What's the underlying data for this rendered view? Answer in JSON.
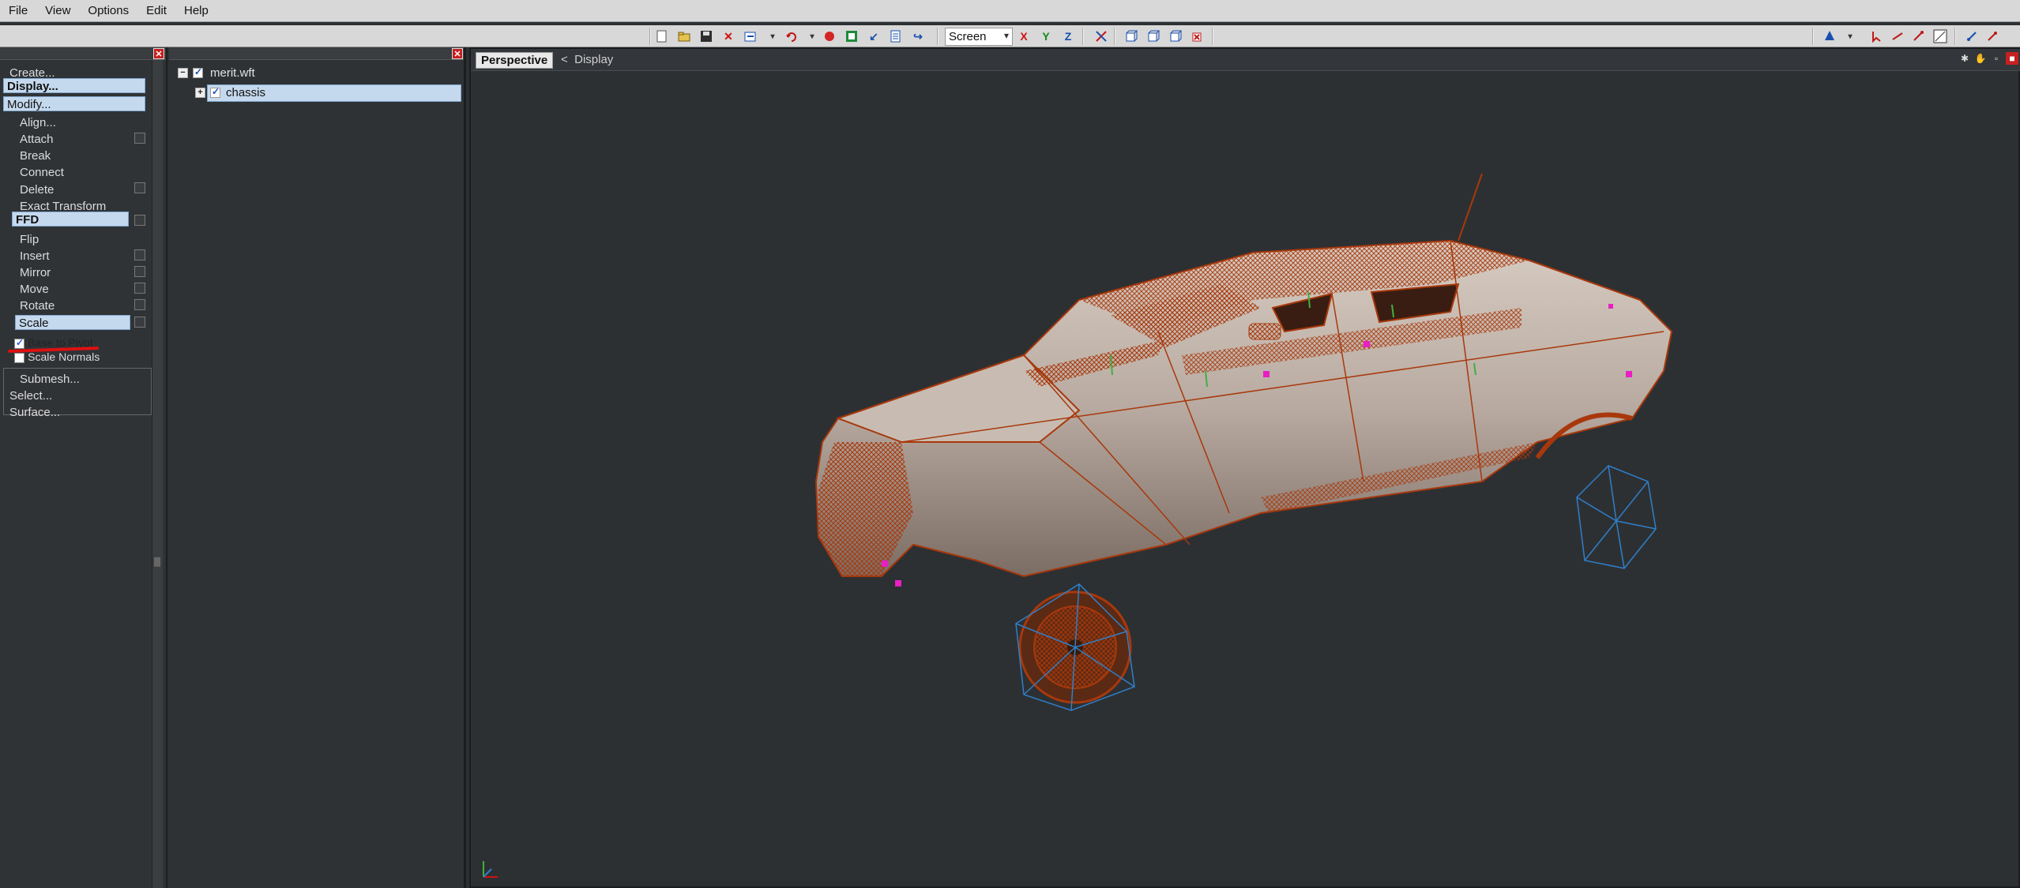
{
  "menu": {
    "file": "File",
    "view": "View",
    "options": "Options",
    "edit": "Edit",
    "help": "Help"
  },
  "toolbar": {
    "space_select": "Screen",
    "axis_x": "X",
    "axis_y": "Y",
    "axis_z": "Z"
  },
  "left_panel": {
    "create": "Create...",
    "display": "Display...",
    "modify": "Modify...",
    "items": [
      "Align...",
      "Attach",
      "Break",
      "Connect",
      "Delete",
      "Exact Transform",
      "FFD",
      "Flip",
      "Insert",
      "Mirror",
      "Move",
      "Rotate",
      "Scale"
    ],
    "option_base_to_pivot": "Base to Pivot",
    "option_scale_normals": "Scale Normals",
    "submesh": "Submesh...",
    "select": "Select...",
    "surface": "Surface..."
  },
  "tree": {
    "root": "merit.wft",
    "child": "chassis"
  },
  "viewport": {
    "tab_active": "Perspective",
    "tab_other": "Display",
    "tab_other_prefix": "<"
  },
  "colors": {
    "wire": "#a8380c",
    "body": "#bfb2a8",
    "highlight": "#c5d9ee",
    "bones": "#2f7fc9",
    "markers": "#e91ec4"
  }
}
